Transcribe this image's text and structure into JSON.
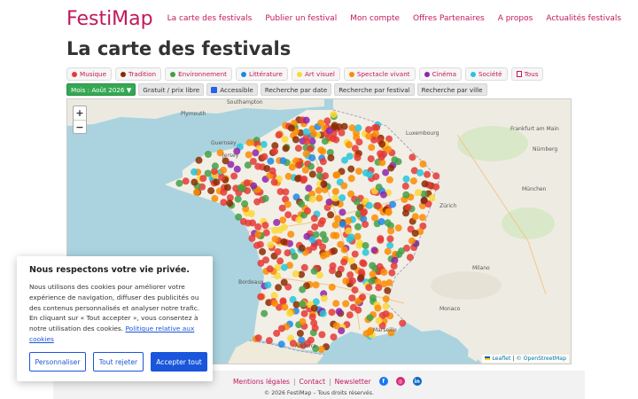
{
  "header": {
    "logo": "FestiMap",
    "nav": [
      "La carte des festivals",
      "Publier un festival",
      "Mon compte",
      "Offres Partenaires",
      "A propos",
      "Actualités festivals"
    ]
  },
  "page_title": "La carte des festivals",
  "categories": [
    {
      "label": "Musique",
      "color": "#e53935"
    },
    {
      "label": "Tradition",
      "color": "#8b2b00"
    },
    {
      "label": "Environnement",
      "color": "#43a047"
    },
    {
      "label": "Littérature",
      "color": "#1e88e5"
    },
    {
      "label": "Art visuel",
      "color": "#fdd835"
    },
    {
      "label": "Spectacle vivant",
      "color": "#fb8c00"
    },
    {
      "label": "Cinéma",
      "color": "#8e24aa"
    },
    {
      "label": "Société",
      "color": "#26c6da"
    },
    {
      "label": "Tous",
      "color": "#c2185b"
    }
  ],
  "filters": {
    "month": "Mois : Août 2026 ▼",
    "free": "Gratuit / prix libre",
    "accessible": "Accessible",
    "by_date": "Recherche par date",
    "by_festival": "Recherche par festival",
    "by_city": "Recherche par ville"
  },
  "map": {
    "zoom_in": "+",
    "zoom_out": "−",
    "attribution_leaflet": "Leaflet",
    "attribution_osm": "© OpenStreetMap",
    "labels": [
      "Plymouth",
      "Southampton",
      "Guernsey",
      "Jersey",
      "Frankfurt am Main",
      "Nürnberg",
      "München",
      "Zürich",
      "Bordeaux",
      "Milano",
      "Monaco",
      "Marseille",
      "Andorra",
      "Luxembourg"
    ]
  },
  "footer": {
    "links": [
      "Mentions légales",
      "Contact",
      "Newsletter"
    ],
    "separator": "|",
    "social": [
      "facebook-icon",
      "instagram-icon",
      "linkedin-icon"
    ],
    "copyright": "© 2026 FestiMap – Tous droits réservés."
  },
  "cookie": {
    "title": "Nous respectons votre vie privée.",
    "text": "Nous utilisons des cookies pour améliorer votre expérience de navigation, diffuser des publicités ou des contenus personnalisés et analyser notre trafic. En cliquant sur « Tout accepter », vous consentez à notre utilisation des cookies.",
    "policy_link": "Politique relative aux cookies",
    "customize": "Personnaliser",
    "reject": "Tout rejeter",
    "accept": "Accepter tout"
  }
}
